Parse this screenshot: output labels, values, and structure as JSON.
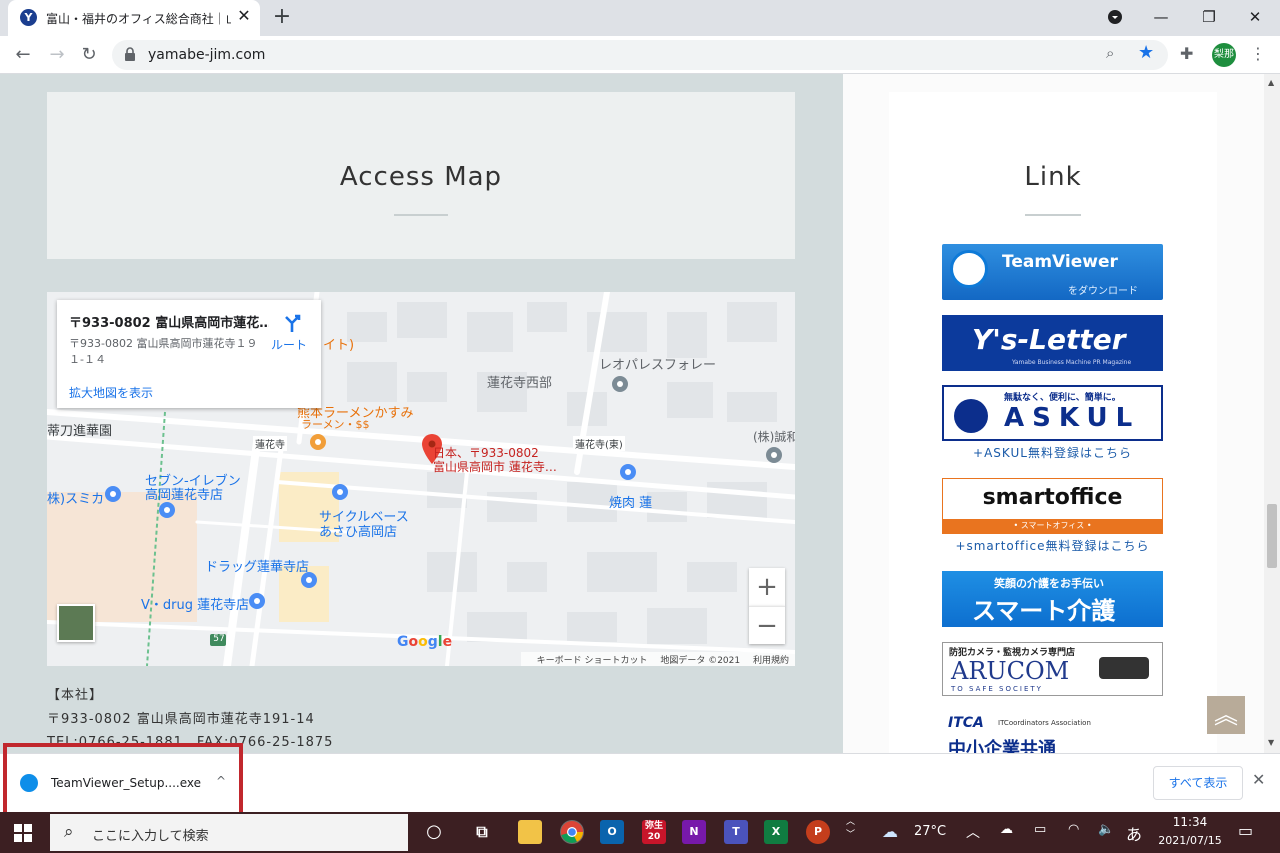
{
  "browser": {
    "tab_title": "富山・福井のオフィス総合商社｜山辺",
    "tab_close": "✕",
    "new_tab": "+",
    "url": "yamabe-jim.com",
    "profile_initials": "梨那",
    "window_buttons": {
      "minimize": "—",
      "restore": "❐",
      "close": "✕"
    }
  },
  "page": {
    "access_title": "Access Map",
    "link_title": "Link",
    "address": {
      "heading": "【本社】",
      "postal_line": "〒933-0802 富山県高岡市蓮花寺191-14",
      "contact_line": "TEL:0766-25-1881　FAX:0766-25-1875"
    }
  },
  "map": {
    "card_title": "〒933-0802 富山県高岡市蓮花…",
    "card_address": "〒933-0802 富山県高岡市蓮花寺１９１-１４",
    "card_link": "拡大地図を表示",
    "route_label": "ルート",
    "pin_label_1": "日本、〒933-0802",
    "pin_label_2": "富山県高岡市 蓮花寺…",
    "places": [
      {
        "name": "蓮花寺西部",
        "color": "#5f6368"
      },
      {
        "name": "レオパレスフォレー",
        "color": "#5f6368"
      },
      {
        "name": "熊本ラーメンかすみ",
        "color": "#e8710a"
      },
      {
        "name": "ラーメン・$$",
        "color": "#e8710a"
      },
      {
        "name": "蒂刀進華園",
        "color": "#3c4043"
      },
      {
        "name": "蓮花寺",
        "color": "#3c4043"
      },
      {
        "name": "蓮花寺(東)",
        "color": "#3c4043"
      },
      {
        "name": "(株)誠和",
        "color": "#5f6368"
      },
      {
        "name": "セブン-イレブン",
        "color": "#1a73e8"
      },
      {
        "name": "高岡蓮花寺店",
        "color": "#1a73e8"
      },
      {
        "name": "株)スミカ",
        "color": "#1a73e8"
      },
      {
        "name": "サイクルベース",
        "color": "#1a73e8"
      },
      {
        "name": "あさひ高岡店",
        "color": "#1a73e8"
      },
      {
        "name": "焼肉 蓮",
        "color": "#1a73e8"
      },
      {
        "name": "ドラッグ蓮華寺店",
        "color": "#1a73e8"
      },
      {
        "name": "V・drug 蓮花寺店",
        "color": "#1a73e8"
      },
      {
        "name": "イト)",
        "color": "#e8710a"
      }
    ],
    "road_number": "57",
    "google": "Google",
    "footer": [
      "キーボード ショートカット",
      "地図データ ©2021",
      "利用規約"
    ],
    "zoom_in": "+",
    "zoom_out": "−"
  },
  "links": {
    "teamviewer": {
      "name": "TeamViewer",
      "sub": "をダウンロード"
    },
    "ysletter": {
      "name": "Y's-Letter",
      "sub": "Yamabe Business Machine PR Magazine"
    },
    "askul": {
      "tagline": "無駄なく、便利に、簡単に。",
      "name": "ASKUL",
      "caption": "+ASKUL無料登録はこちら"
    },
    "smartoffice": {
      "name": "smartoffice",
      "sub": "• スマートオフィス •",
      "caption": "+smartoffice無料登録はこちら"
    },
    "kaigo": {
      "line1": "笑顔の介護をお手伝い",
      "line2": "スマート介護"
    },
    "arucom": {
      "tagline": "防犯カメラ・監視カメラ専門店",
      "name": "ARUCOM",
      "sub": "TO SAFE SOCIETY"
    },
    "itca": {
      "name": "ITCA",
      "sub": "ITCoordinators Association",
      "jp": "中小企業共通"
    }
  },
  "back_to_top": "︽",
  "download_shelf": {
    "file_name": "TeamViewer_Setup....exe",
    "caret": "^",
    "show_all": "すべて表示",
    "close": "✕"
  },
  "taskbar": {
    "search_placeholder": "ここに入力して検索",
    "yayoi_label": "弥生\n20",
    "weather": "27°C",
    "ime": "あ",
    "time": "11:34",
    "date": "2021/07/15"
  }
}
